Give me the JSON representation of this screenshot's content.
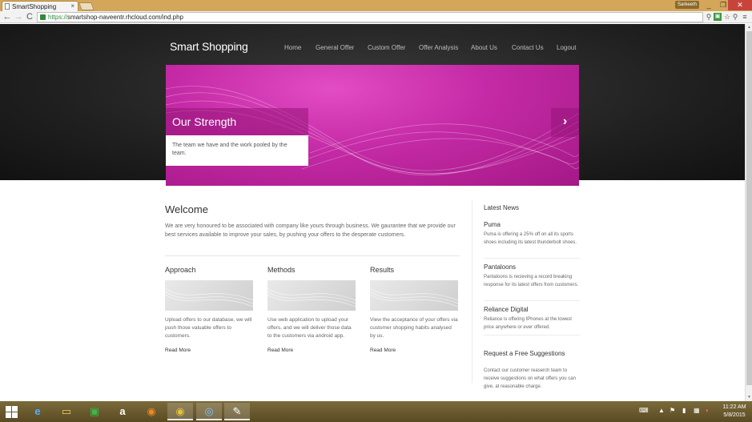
{
  "browser": {
    "tab_title": "SmartShopping",
    "tab_close": "×",
    "user_badge": "Sarkeeth",
    "url_scheme": "https://",
    "url_rest": "smartshop-naveentr.rhcloud.com/ind.php",
    "nav": {
      "back": "←",
      "forward": "→",
      "reload": "C"
    },
    "window_buttons": {
      "minimize": "_",
      "maximize": "❐",
      "close": "✕"
    }
  },
  "site": {
    "logo": "Smart Shopping",
    "menu": [
      "Home",
      "General Offer",
      "Custom Offer",
      "Offer Analysis",
      "About Us",
      "Contact Us",
      "Logout"
    ],
    "slider": {
      "caption_title": "Our Strength",
      "caption_text": "The team we have and the work pooled by the team.",
      "next_glyph": "›"
    },
    "welcome": {
      "title": "Welcome",
      "text": "We are very honoured to be associated with company like yours through business. We gaurantee that we provide our best services available to improve your sales, by pushing your offers to the desperate customers."
    },
    "columns": [
      {
        "title": "Approach",
        "text": "Upload offers to our database, we will push those valuable offers to customers.",
        "more": "Read More"
      },
      {
        "title": "Methods",
        "text": "Use web application to upload your offers, and we will deliver those data to the customers via android app.",
        "more": "Read More"
      },
      {
        "title": "Results",
        "text": "View the acceptance of your offers via customer shopping habits analysed by us.",
        "more": "Read More"
      }
    ],
    "news": {
      "title": "Latest News",
      "items": [
        {
          "heading": "Puma",
          "text": "Puma is offering a 25% off on all its sports shoes including its latest thunderbolt shoes."
        },
        {
          "heading": "Pantaloons",
          "text": "Pantaloons is recieving a record breaking response for its latest offers from customers."
        },
        {
          "heading": "Reliance Digital",
          "text": "Reliance is offering IPhones at the lowest price anywhere or ever offered."
        }
      ]
    },
    "request": {
      "title": "Request a Free Suggestions",
      "text": "Contact our customer reaserch team to receive suggestions on what offers you can give, at reasonable charge."
    }
  },
  "taskbar": {
    "apps": [
      "ie-icon",
      "file-explorer-icon",
      "store-icon",
      "amazon-icon",
      "firefox-icon",
      "chrome-icon",
      "app-icon",
      "paint-icon"
    ],
    "app_glyphs": [
      "e",
      "▭",
      "▣",
      "a",
      "◉",
      "◉",
      "◎",
      "✎"
    ],
    "clock_time": "11:22 AM",
    "clock_date": "5/8/2015"
  },
  "colors": {
    "accent": "#c42aa5",
    "dark_header": "#1e1e1e",
    "taskbar": "#6b5a2c"
  }
}
